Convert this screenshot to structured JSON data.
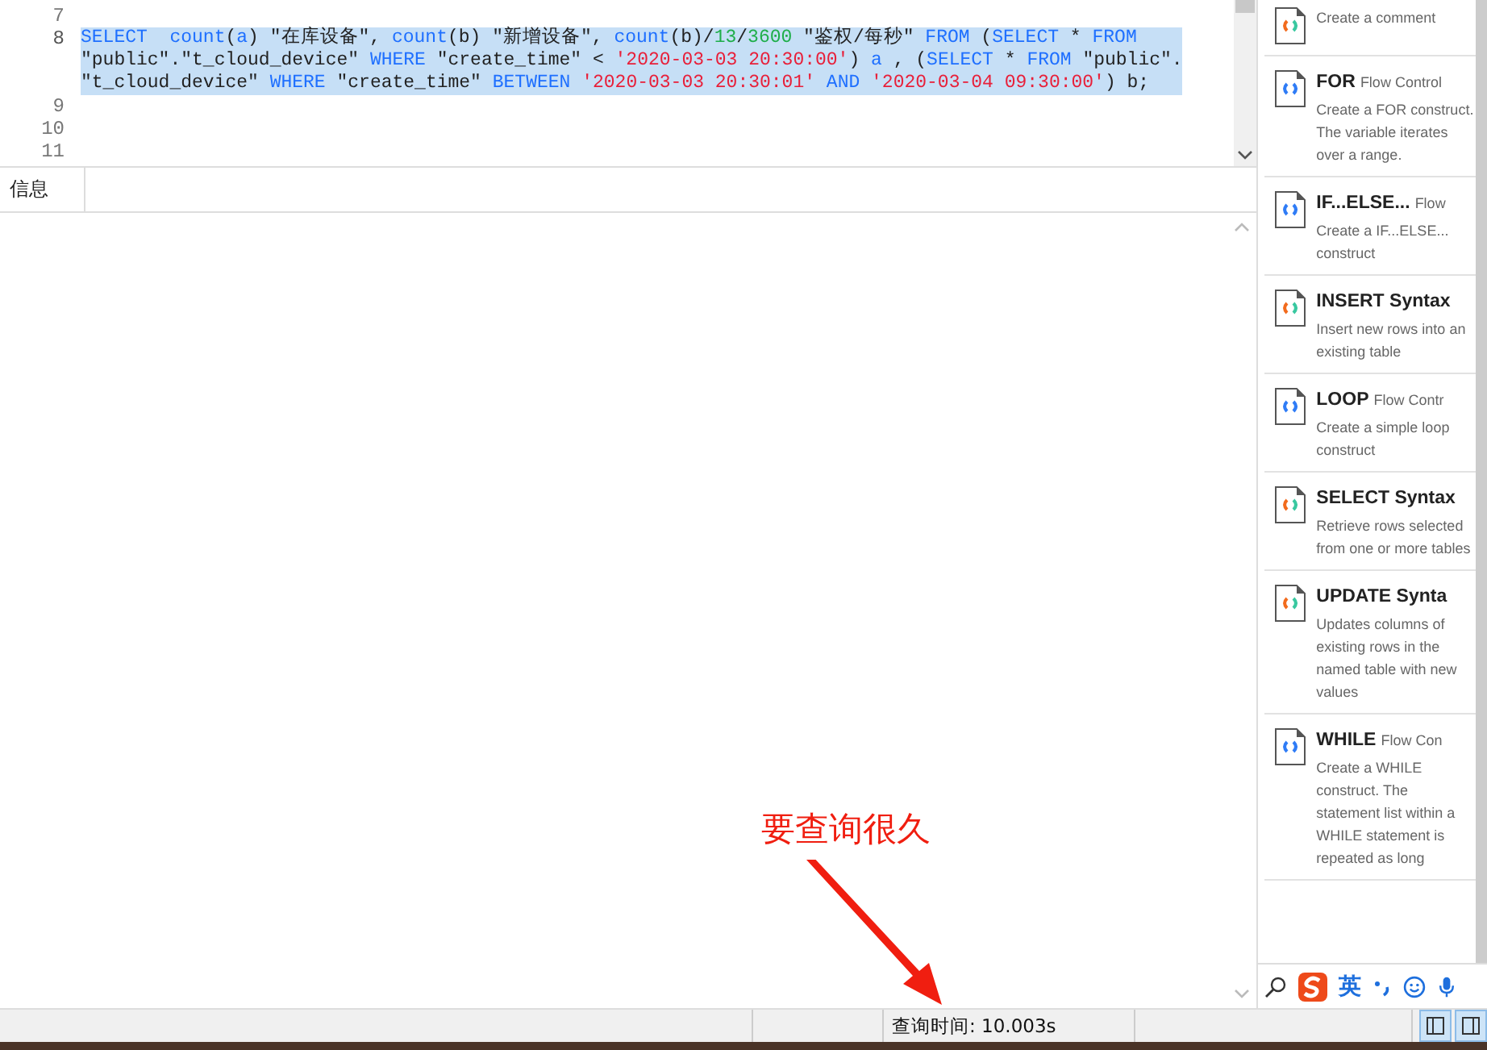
{
  "editor": {
    "lines": [
      {
        "number": "7",
        "selected": false
      },
      {
        "number": "8",
        "selected": true,
        "rows": [
          {
            "tokens": [
              {
                "kind": "kw",
                "text": "SELECT"
              },
              {
                "kind": "fn",
                "text": "  count"
              },
              {
                "kind": "plain",
                "text": "("
              },
              {
                "kind": "kw",
                "text": "a"
              },
              {
                "kind": "plain",
                "text": ") \"在库设备\", "
              },
              {
                "kind": "fn",
                "text": "count"
              },
              {
                "kind": "plain",
                "text": "(b) \"新增设备\", "
              },
              {
                "kind": "fn",
                "text": "count"
              },
              {
                "kind": "plain",
                "text": "(b)/"
              },
              {
                "kind": "num",
                "text": "13"
              },
              {
                "kind": "plain",
                "text": "/"
              },
              {
                "kind": "num",
                "text": "3600"
              },
              {
                "kind": "plain",
                "text": " \"鉴权/每秒\" "
              },
              {
                "kind": "kw",
                "text": "FROM"
              },
              {
                "kind": "plain",
                "text": " ("
              },
              {
                "kind": "kw",
                "text": "SELECT"
              },
              {
                "kind": "plain",
                "text": " * "
              },
              {
                "kind": "kw",
                "text": "FROM"
              }
            ]
          },
          {
            "tokens": [
              {
                "kind": "plain",
                "text": "\"public\".\"t_cloud_device\" "
              },
              {
                "kind": "kw",
                "text": "WHERE"
              },
              {
                "kind": "plain",
                "text": " \"create_time\" < "
              },
              {
                "kind": "str",
                "text": "'2020-03-03 20:30:00'"
              },
              {
                "kind": "plain",
                "text": ") "
              },
              {
                "kind": "kw",
                "text": "a"
              },
              {
                "kind": "plain",
                "text": " , ("
              },
              {
                "kind": "kw",
                "text": "SELECT"
              },
              {
                "kind": "plain",
                "text": " * "
              },
              {
                "kind": "kw",
                "text": "FROM"
              },
              {
                "kind": "plain",
                "text": " \"public\"."
              }
            ]
          },
          {
            "tokens": [
              {
                "kind": "plain",
                "text": "\"t_cloud_device\" "
              },
              {
                "kind": "kw",
                "text": "WHERE"
              },
              {
                "kind": "plain",
                "text": " \"create_time\" "
              },
              {
                "kind": "kw",
                "text": "BETWEEN"
              },
              {
                "kind": "str",
                "text": " '2020-03-03 20:30:01'"
              },
              {
                "kind": "kw",
                "text": " AND"
              },
              {
                "kind": "str",
                "text": " '2020-03-04 09:30:00'"
              },
              {
                "kind": "plain",
                "text": ") b;"
              }
            ]
          }
        ]
      },
      {
        "number": "9",
        "selected": false
      },
      {
        "number": "10",
        "selected": false
      },
      {
        "number": "11",
        "selected": false
      }
    ]
  },
  "result_tabs": [
    {
      "label": "信息",
      "selected": true
    }
  ],
  "annotation": {
    "text": "要查询很久"
  },
  "snippets": [
    {
      "kind": "syntax",
      "description": "Create a comment"
    },
    {
      "kind": "flow",
      "title": "FOR",
      "category": "Flow Control",
      "description": "Create a FOR construct. The variable iterates over a range."
    },
    {
      "kind": "flow",
      "title": "IF...ELSE...",
      "category": "Flow",
      "description": "Create a IF...ELSE... construct"
    },
    {
      "kind": "syntax",
      "title": "INSERT Syntax",
      "description": "Insert new rows into an existing table"
    },
    {
      "kind": "flow",
      "title": "LOOP",
      "category": "Flow Contr",
      "description": "Create a simple loop construct"
    },
    {
      "kind": "syntax",
      "title": "SELECT Syntax",
      "description": "Retrieve rows selected from one or more tables"
    },
    {
      "kind": "syntax",
      "title": "UPDATE Synta",
      "description": "Updates columns of existing rows in the named table with new values"
    },
    {
      "kind": "flow",
      "title": "WHILE",
      "category": "Flow Con",
      "description": "Create a WHILE construct. The statement list within a WHILE statement is repeated as long"
    }
  ],
  "ime_bar": {
    "language": "英"
  },
  "status_bar": {
    "query_time": "查询时间: 10.003s"
  }
}
